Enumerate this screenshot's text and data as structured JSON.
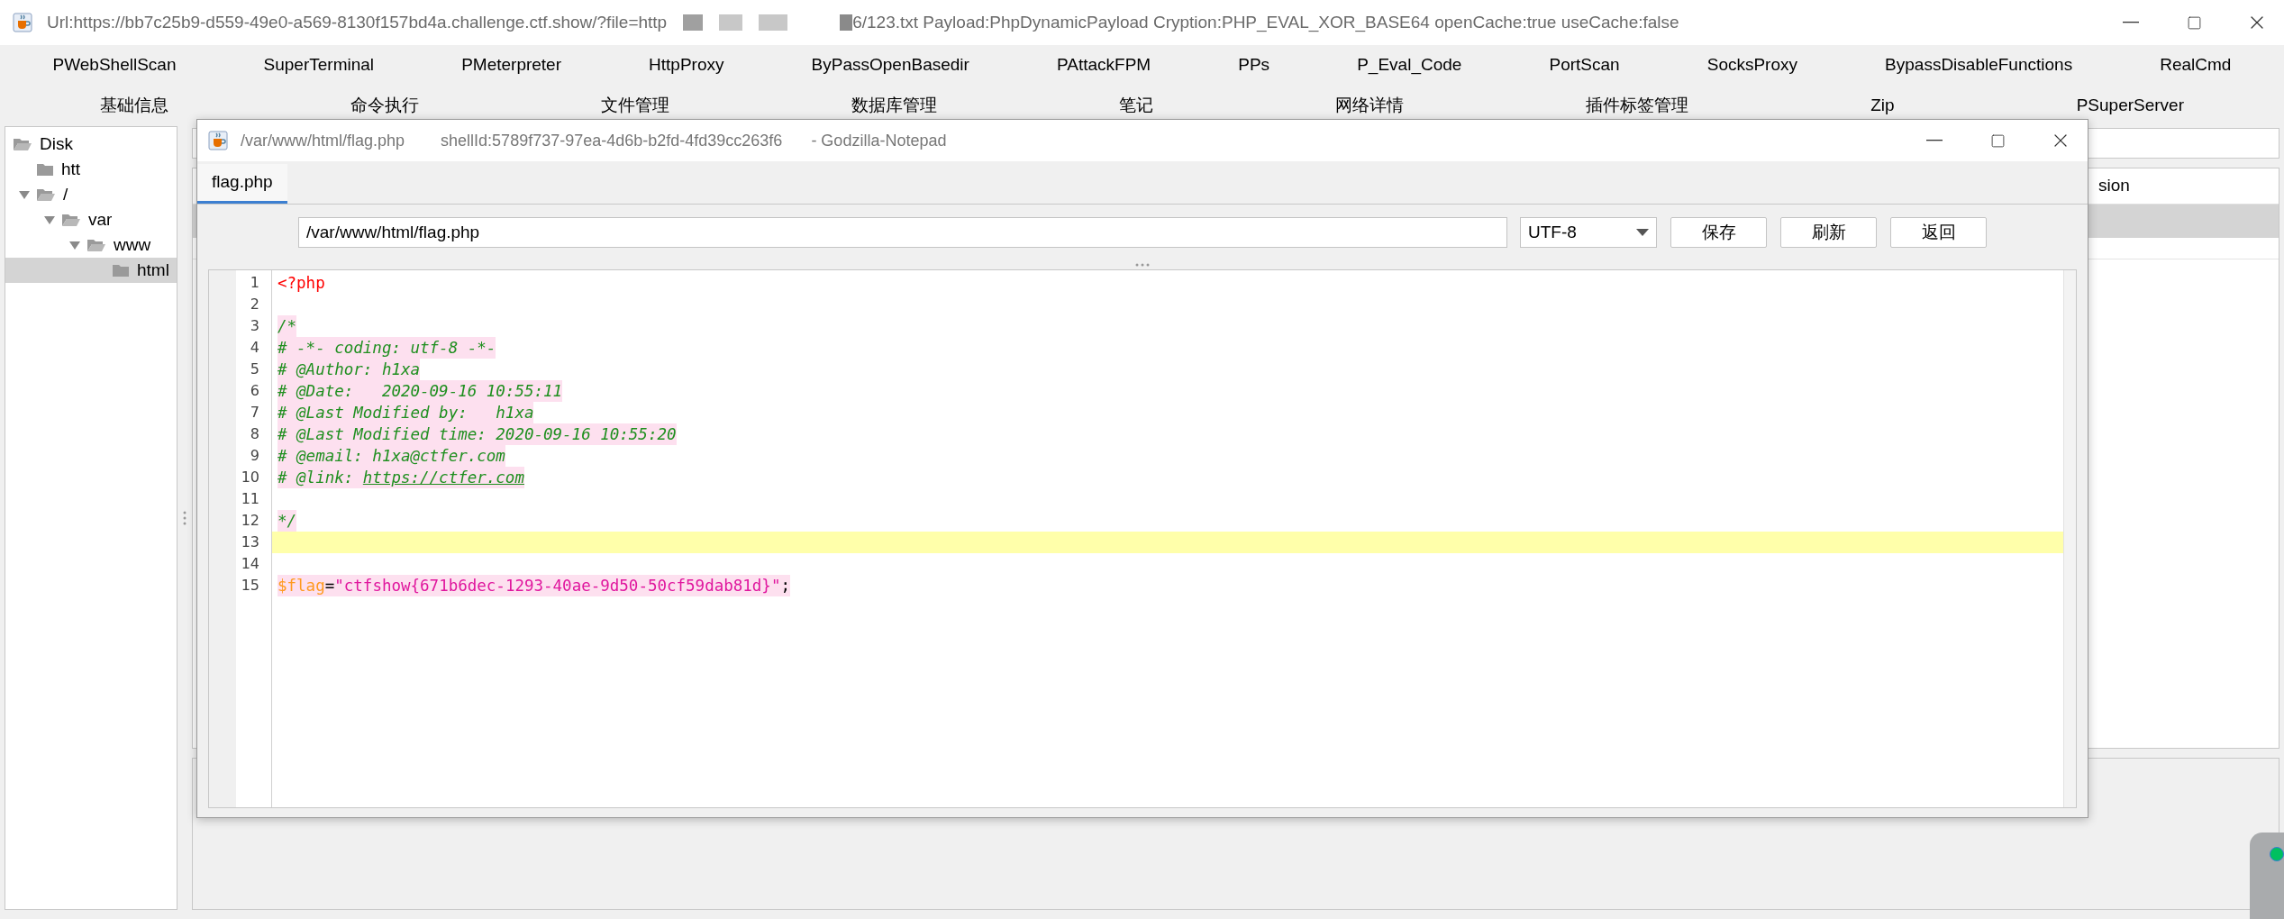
{
  "window": {
    "title": "Url:https://bb7c25b9-d559-49e0-a569-8130f157bd4a.challenge.ctf.show/?file=http",
    "title_tail": "6/123.txt Payload:PhpDynamicPayload Cryption:PHP_EVAL_XOR_BASE64 openCache:true useCache:false"
  },
  "plugin_tabs": [
    "PWebShellScan",
    "SuperTerminal",
    "PMeterpreter",
    "HttpProxy",
    "ByPassOpenBasedir",
    "PAttackFPM",
    "PPs",
    "P_Eval_Code",
    "PortScan",
    "SocksProxy",
    "BypassDisableFunctions",
    "RealCmd"
  ],
  "main_tabs": [
    "基础信息",
    "命令执行",
    "文件管理",
    "数据库管理",
    "笔记",
    "网络详情",
    "插件标签管理",
    "Zip",
    "PSuperServer"
  ],
  "file_tree": [
    {
      "label": "Disk",
      "expanded": true,
      "selected": false,
      "children": [
        {
          "label": "htt",
          "expanded": false,
          "selected": false
        },
        {
          "label": "/",
          "expanded": true,
          "selected": false,
          "children": [
            {
              "label": "var",
              "expanded": true,
              "selected": false,
              "children": [
                {
                  "label": "www",
                  "expanded": true,
                  "selected": false,
                  "children": [
                    {
                      "label": "html",
                      "expanded": false,
                      "selected": true
                    }
                  ]
                }
              ]
            }
          ]
        }
      ]
    }
  ],
  "file_table": {
    "column_1": "sion"
  },
  "notepad": {
    "title": "/var/www/html/flag.php",
    "shell_id": "shellId:5789f737-97ea-4d6b-b2fd-4fd39cc263f6",
    "app_name": "- Godzilla-Notepad",
    "tabs": [
      {
        "label": "flag.php",
        "selected": true
      }
    ],
    "path": "/var/www/html/flag.php",
    "encoding": "UTF-8",
    "buttons": [
      "保存",
      "刷新",
      "返回"
    ],
    "lines": [
      {
        "number": "1",
        "current": false,
        "segments": [
          {
            "kind": "tag",
            "text": "<?php"
          }
        ]
      },
      {
        "number": "2",
        "current": false
      },
      {
        "number": "3",
        "current": false,
        "segments": [
          {
            "kind": "comment",
            "text": "/*"
          }
        ]
      },
      {
        "number": "4",
        "current": false,
        "segments": [
          {
            "kind": "comment",
            "text": "# -*- coding: utf-8 -*-"
          }
        ]
      },
      {
        "number": "5",
        "current": false,
        "segments": [
          {
            "kind": "comment",
            "text": "# @Author: h1xa"
          }
        ]
      },
      {
        "number": "6",
        "current": false,
        "segments": [
          {
            "kind": "comment",
            "text": "# @Date:   2020-09-16 10:55:11"
          }
        ]
      },
      {
        "number": "7",
        "current": false,
        "segments": [
          {
            "kind": "comment",
            "text": "# @Last Modified by:   h1xa"
          }
        ]
      },
      {
        "number": "8",
        "current": false,
        "segments": [
          {
            "kind": "comment",
            "text": "# @Last Modified time: 2020-09-16 10:55:20"
          }
        ]
      },
      {
        "number": "9",
        "current": false,
        "segments": [
          {
            "kind": "comment",
            "text": "# @email: h1xa@ctfer.com"
          }
        ]
      },
      {
        "number": "10",
        "current": false,
        "segments": [
          {
            "kind": "comment",
            "text": "# @link: "
          },
          {
            "kind": "link",
            "text": "https://ctfer.com"
          }
        ]
      },
      {
        "number": "11",
        "current": false
      },
      {
        "number": "12",
        "current": false,
        "segments": [
          {
            "kind": "comment",
            "text": "*/"
          }
        ]
      },
      {
        "number": "13",
        "current": true
      },
      {
        "number": "14",
        "current": false
      },
      {
        "number": "15",
        "current": false,
        "segments": [
          {
            "kind": "variable",
            "text": "$flag"
          },
          {
            "kind": "operator",
            "text": "="
          },
          {
            "kind": "string",
            "text": "\"ctfshow{671b6dec-1293-40ae-9d50-50cf59dab81d}\""
          },
          {
            "kind": "operator",
            "text": ";"
          }
        ]
      }
    ]
  }
}
